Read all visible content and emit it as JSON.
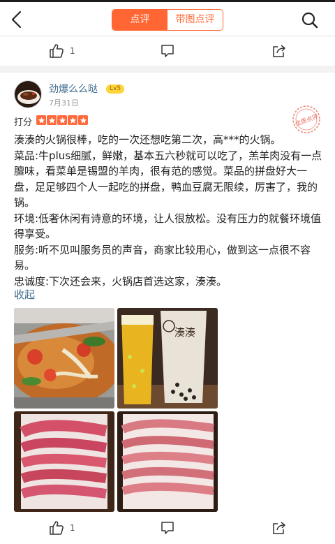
{
  "header": {
    "tabs": [
      {
        "label": "点评",
        "active": true
      },
      {
        "label": "带图点评",
        "active": false
      }
    ],
    "accent_color": "#ff6633"
  },
  "top_actions": {
    "like_count": "1"
  },
  "review": {
    "username": "劲爆么么哒",
    "level_badge": "Lv5",
    "date": "7月31日",
    "score_label": "打分",
    "rating": 5,
    "stamp_text": "优质点评",
    "paragraphs": [
      "湊湊的火锅很棒，吃的一次还想吃第二次，高***的火锅。",
      "菜品:牛plus细腻，鲜嫩，基本五六秒就可以吃了，羔羊肉没有一点膻味，看菜单是锡盟的羊肉，很有范的感觉。菜品的拼盘好大一盘，足足够四个人一起吃的拼盘，鸭血豆腐无限续，厉害了，我的锅。",
      "环境:低奢休闲有诗意的环境，让人很放松。没有压力的就餐环境值得享受。",
      "服务:听不见叫服务员的声音，商家比较用心，做到这一点很不容易。",
      "忠诚度:下次还会来，火锅店首选这家，湊湊。"
    ],
    "collapse_label": "收起",
    "photos": [
      {
        "name": "hotpot-photo",
        "cup_text": ""
      },
      {
        "name": "drinks-photo",
        "cup_text": "湊湊"
      },
      {
        "name": "beef-slices-photo",
        "cup_text": ""
      },
      {
        "name": "lamb-slices-photo",
        "cup_text": ""
      }
    ],
    "like_count": "1"
  }
}
